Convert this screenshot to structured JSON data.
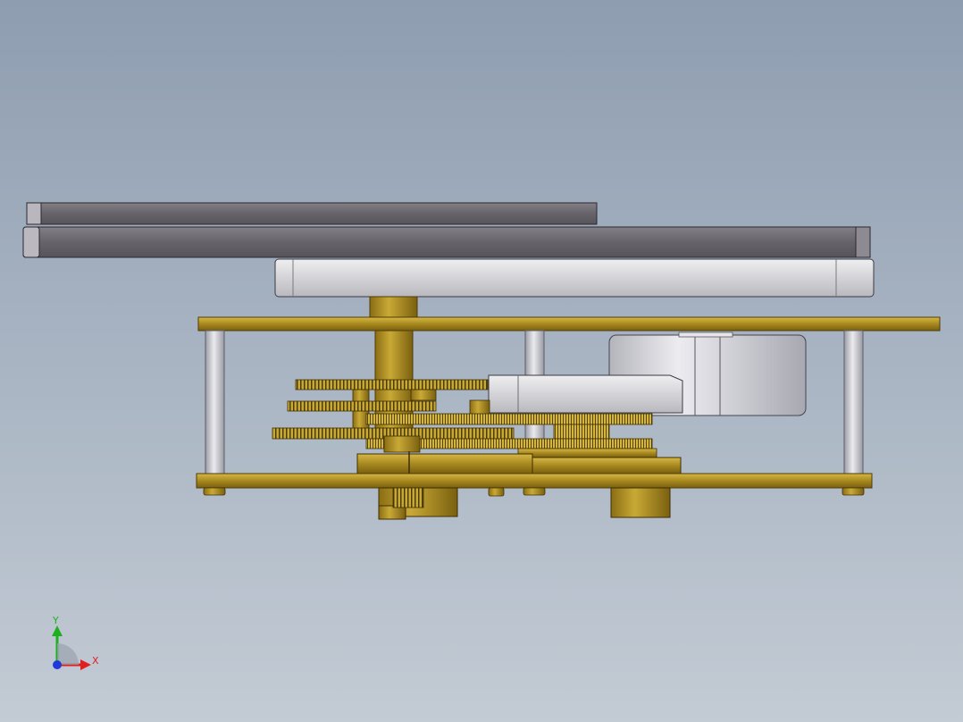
{
  "viewport": {
    "background_top": "#8e9db0",
    "background_bottom": "#c3cbd4"
  },
  "colors": {
    "dark_plate": "#67636a",
    "light_plate": "#d4d4d8",
    "brass": "#b39427",
    "brass_dark": "#7a6010",
    "brass_light": "#d7b845",
    "pillar": "#c8c9d0",
    "barrel": "#d6d6da"
  },
  "triad": {
    "x_label": "X",
    "y_label": "Y",
    "x_color": "#e02020",
    "y_color": "#1fb01f",
    "z_color": "#1f3ad8"
  }
}
